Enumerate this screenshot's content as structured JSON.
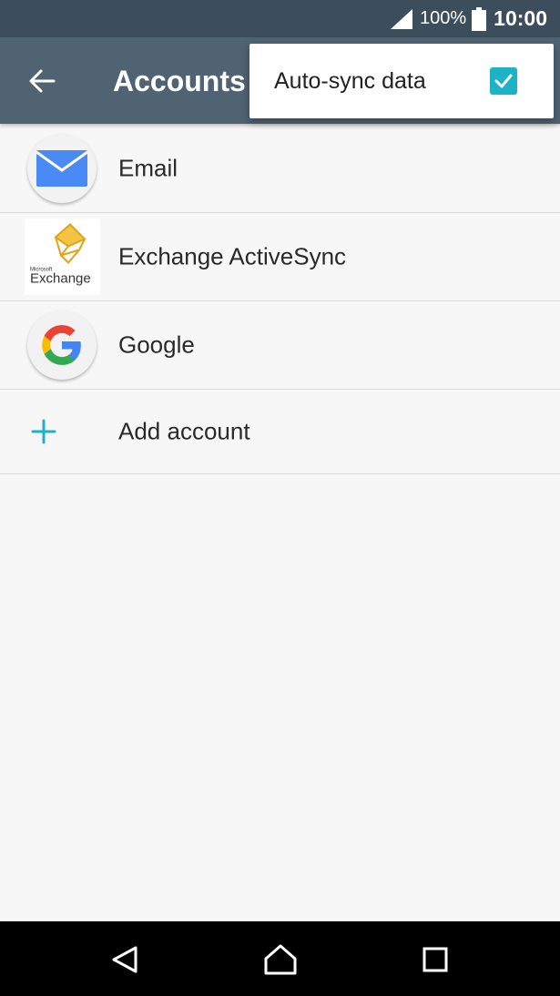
{
  "status_bar": {
    "battery_percent": "100%",
    "time": "10:00",
    "icons": [
      "signal-icon",
      "battery-icon"
    ]
  },
  "app_bar": {
    "title": "Accounts",
    "back_icon": "back-arrow-icon"
  },
  "popup_menu": {
    "items": [
      {
        "label": "Auto-sync data",
        "checked": true
      }
    ],
    "accent_color": "#1cb3c7"
  },
  "accounts": [
    {
      "label": "Email",
      "icon": "email-icon"
    },
    {
      "label": "Exchange ActiveSync",
      "icon": "exchange-icon",
      "logo_text": [
        "Microsoft",
        "Exchange"
      ]
    },
    {
      "label": "Google",
      "icon": "google-icon"
    },
    {
      "label": "Add account",
      "icon": "plus-icon"
    }
  ],
  "nav_bar": {
    "buttons": [
      "back-nav-icon",
      "home-nav-icon",
      "recents-nav-icon"
    ]
  },
  "colors": {
    "status_bar": "#3c4e5c",
    "app_bar": "#4f6372",
    "background": "#f7f7f7",
    "accent": "#1cb3c7"
  }
}
